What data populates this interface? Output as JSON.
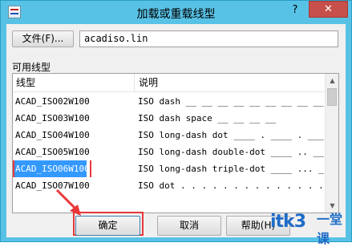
{
  "window": {
    "title": "加载或重载线型",
    "help_label": "?",
    "close_label": "✕"
  },
  "file": {
    "button_label": "文件(F)...",
    "value": "acadiso.lin"
  },
  "linetypes": {
    "section_label": "可用线型",
    "col_name": "线型",
    "col_desc": "说明",
    "rows": [
      {
        "name": "ACAD_ISO02W100",
        "desc": "ISO dash __ __ __ __ __ __ __ __ __"
      },
      {
        "name": "ACAD_ISO03W100",
        "desc": "ISO dash space __    __    __    __"
      },
      {
        "name": "ACAD_ISO04W100",
        "desc": "ISO long-dash dot ____ . ____ . ____"
      },
      {
        "name": "ACAD_ISO05W100",
        "desc": "ISO long-dash double-dot ____ .. ____"
      },
      {
        "name": "ACAD_ISO06W100",
        "desc": "ISO long-dash triple-dot ____ ... ___"
      },
      {
        "name": "ACAD_ISO07W100",
        "desc": "ISO dot . . . . . . . . . . . . . . ."
      }
    ],
    "selected_index": 4
  },
  "buttons": {
    "ok": "确定",
    "cancel": "取消",
    "help": "帮助(H)"
  },
  "watermark": {
    "logo": "itk3",
    "sub": "一堂课"
  },
  "colors": {
    "titlebar": "#58c2e6",
    "selection": "#3399ff",
    "highlight_red": "#e8373a"
  }
}
